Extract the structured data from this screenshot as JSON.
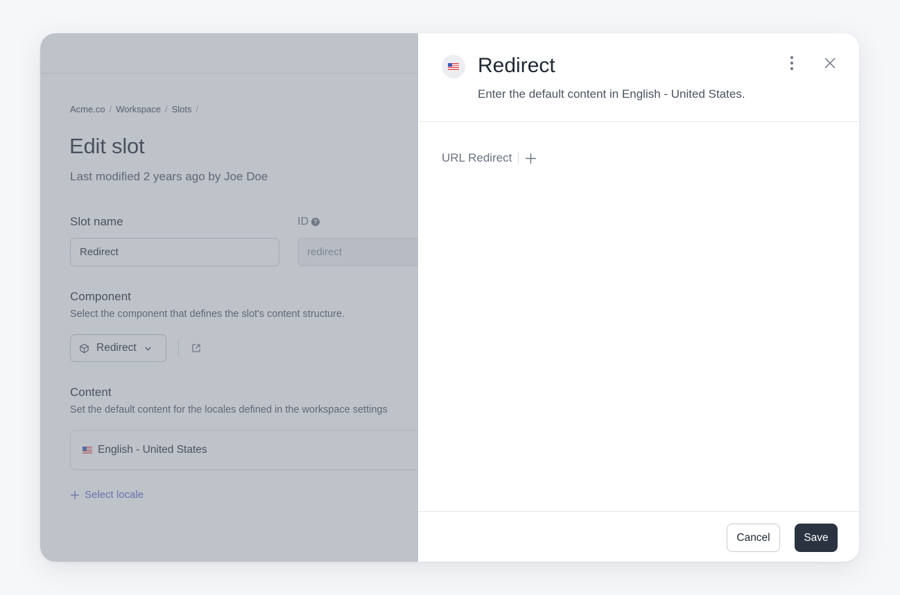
{
  "breadcrumb": [
    "Acme.co",
    "Workspace",
    "Slots"
  ],
  "page": {
    "title": "Edit slot",
    "subtitle": "Last modified 2 years ago by Joe Doe",
    "slot_name_label": "Slot name",
    "slot_name_value": "Redirect",
    "id_label": "ID",
    "id_value": "redirect",
    "component_label": "Component",
    "component_help": "Select the component that defines the slot's content structure.",
    "component_value": "Redirect",
    "content_label": "Content",
    "content_help": "Set the default content for the locales defined in the workspace settings",
    "locale": "English - United States",
    "add_locale": "Select locale"
  },
  "drawer": {
    "title": "Redirect",
    "subtitle": "Enter the default content in English - United States.",
    "field_label": "URL Redirect",
    "cancel": "Cancel",
    "save": "Save"
  },
  "icons": {
    "flag": "us-flag-icon",
    "component": "cube-icon",
    "chevron": "chevron-down-icon",
    "external": "external-link-icon",
    "more": "kebab-menu-icon",
    "close": "close-icon",
    "add": "plus-icon",
    "help": "question-circle-icon"
  },
  "colors": {
    "primary_button": "#2b3340",
    "link": "#5866c4",
    "overlay": "#78808e"
  }
}
